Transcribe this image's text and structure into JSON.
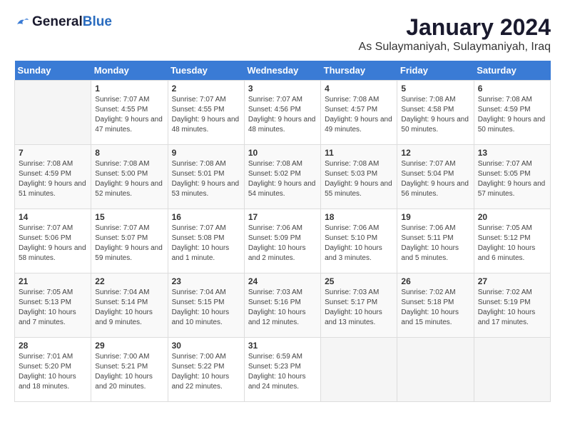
{
  "header": {
    "logo_general": "General",
    "logo_blue": "Blue",
    "month_title": "January 2024",
    "location": "As Sulaymaniyah, Sulaymaniyah, Iraq"
  },
  "weekdays": [
    "Sunday",
    "Monday",
    "Tuesday",
    "Wednesday",
    "Thursday",
    "Friday",
    "Saturday"
  ],
  "weeks": [
    [
      {
        "day": "",
        "sunrise": "",
        "sunset": "",
        "daylight": ""
      },
      {
        "day": "1",
        "sunrise": "Sunrise: 7:07 AM",
        "sunset": "Sunset: 4:55 PM",
        "daylight": "Daylight: 9 hours and 47 minutes."
      },
      {
        "day": "2",
        "sunrise": "Sunrise: 7:07 AM",
        "sunset": "Sunset: 4:55 PM",
        "daylight": "Daylight: 9 hours and 48 minutes."
      },
      {
        "day": "3",
        "sunrise": "Sunrise: 7:07 AM",
        "sunset": "Sunset: 4:56 PM",
        "daylight": "Daylight: 9 hours and 48 minutes."
      },
      {
        "day": "4",
        "sunrise": "Sunrise: 7:08 AM",
        "sunset": "Sunset: 4:57 PM",
        "daylight": "Daylight: 9 hours and 49 minutes."
      },
      {
        "day": "5",
        "sunrise": "Sunrise: 7:08 AM",
        "sunset": "Sunset: 4:58 PM",
        "daylight": "Daylight: 9 hours and 50 minutes."
      },
      {
        "day": "6",
        "sunrise": "Sunrise: 7:08 AM",
        "sunset": "Sunset: 4:59 PM",
        "daylight": "Daylight: 9 hours and 50 minutes."
      }
    ],
    [
      {
        "day": "7",
        "sunrise": "Sunrise: 7:08 AM",
        "sunset": "Sunset: 4:59 PM",
        "daylight": "Daylight: 9 hours and 51 minutes."
      },
      {
        "day": "8",
        "sunrise": "Sunrise: 7:08 AM",
        "sunset": "Sunset: 5:00 PM",
        "daylight": "Daylight: 9 hours and 52 minutes."
      },
      {
        "day": "9",
        "sunrise": "Sunrise: 7:08 AM",
        "sunset": "Sunset: 5:01 PM",
        "daylight": "Daylight: 9 hours and 53 minutes."
      },
      {
        "day": "10",
        "sunrise": "Sunrise: 7:08 AM",
        "sunset": "Sunset: 5:02 PM",
        "daylight": "Daylight: 9 hours and 54 minutes."
      },
      {
        "day": "11",
        "sunrise": "Sunrise: 7:08 AM",
        "sunset": "Sunset: 5:03 PM",
        "daylight": "Daylight: 9 hours and 55 minutes."
      },
      {
        "day": "12",
        "sunrise": "Sunrise: 7:07 AM",
        "sunset": "Sunset: 5:04 PM",
        "daylight": "Daylight: 9 hours and 56 minutes."
      },
      {
        "day": "13",
        "sunrise": "Sunrise: 7:07 AM",
        "sunset": "Sunset: 5:05 PM",
        "daylight": "Daylight: 9 hours and 57 minutes."
      }
    ],
    [
      {
        "day": "14",
        "sunrise": "Sunrise: 7:07 AM",
        "sunset": "Sunset: 5:06 PM",
        "daylight": "Daylight: 9 hours and 58 minutes."
      },
      {
        "day": "15",
        "sunrise": "Sunrise: 7:07 AM",
        "sunset": "Sunset: 5:07 PM",
        "daylight": "Daylight: 9 hours and 59 minutes."
      },
      {
        "day": "16",
        "sunrise": "Sunrise: 7:07 AM",
        "sunset": "Sunset: 5:08 PM",
        "daylight": "Daylight: 10 hours and 1 minute."
      },
      {
        "day": "17",
        "sunrise": "Sunrise: 7:06 AM",
        "sunset": "Sunset: 5:09 PM",
        "daylight": "Daylight: 10 hours and 2 minutes."
      },
      {
        "day": "18",
        "sunrise": "Sunrise: 7:06 AM",
        "sunset": "Sunset: 5:10 PM",
        "daylight": "Daylight: 10 hours and 3 minutes."
      },
      {
        "day": "19",
        "sunrise": "Sunrise: 7:06 AM",
        "sunset": "Sunset: 5:11 PM",
        "daylight": "Daylight: 10 hours and 5 minutes."
      },
      {
        "day": "20",
        "sunrise": "Sunrise: 7:05 AM",
        "sunset": "Sunset: 5:12 PM",
        "daylight": "Daylight: 10 hours and 6 minutes."
      }
    ],
    [
      {
        "day": "21",
        "sunrise": "Sunrise: 7:05 AM",
        "sunset": "Sunset: 5:13 PM",
        "daylight": "Daylight: 10 hours and 7 minutes."
      },
      {
        "day": "22",
        "sunrise": "Sunrise: 7:04 AM",
        "sunset": "Sunset: 5:14 PM",
        "daylight": "Daylight: 10 hours and 9 minutes."
      },
      {
        "day": "23",
        "sunrise": "Sunrise: 7:04 AM",
        "sunset": "Sunset: 5:15 PM",
        "daylight": "Daylight: 10 hours and 10 minutes."
      },
      {
        "day": "24",
        "sunrise": "Sunrise: 7:03 AM",
        "sunset": "Sunset: 5:16 PM",
        "daylight": "Daylight: 10 hours and 12 minutes."
      },
      {
        "day": "25",
        "sunrise": "Sunrise: 7:03 AM",
        "sunset": "Sunset: 5:17 PM",
        "daylight": "Daylight: 10 hours and 13 minutes."
      },
      {
        "day": "26",
        "sunrise": "Sunrise: 7:02 AM",
        "sunset": "Sunset: 5:18 PM",
        "daylight": "Daylight: 10 hours and 15 minutes."
      },
      {
        "day": "27",
        "sunrise": "Sunrise: 7:02 AM",
        "sunset": "Sunset: 5:19 PM",
        "daylight": "Daylight: 10 hours and 17 minutes."
      }
    ],
    [
      {
        "day": "28",
        "sunrise": "Sunrise: 7:01 AM",
        "sunset": "Sunset: 5:20 PM",
        "daylight": "Daylight: 10 hours and 18 minutes."
      },
      {
        "day": "29",
        "sunrise": "Sunrise: 7:00 AM",
        "sunset": "Sunset: 5:21 PM",
        "daylight": "Daylight: 10 hours and 20 minutes."
      },
      {
        "day": "30",
        "sunrise": "Sunrise: 7:00 AM",
        "sunset": "Sunset: 5:22 PM",
        "daylight": "Daylight: 10 hours and 22 minutes."
      },
      {
        "day": "31",
        "sunrise": "Sunrise: 6:59 AM",
        "sunset": "Sunset: 5:23 PM",
        "daylight": "Daylight: 10 hours and 24 minutes."
      },
      {
        "day": "",
        "sunrise": "",
        "sunset": "",
        "daylight": ""
      },
      {
        "day": "",
        "sunrise": "",
        "sunset": "",
        "daylight": ""
      },
      {
        "day": "",
        "sunrise": "",
        "sunset": "",
        "daylight": ""
      }
    ]
  ]
}
